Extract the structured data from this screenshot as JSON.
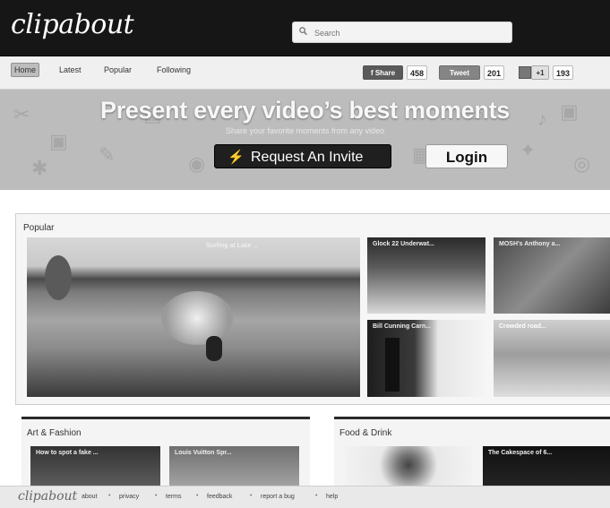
{
  "header": {
    "logo": "clipabout",
    "search_placeholder": "Search"
  },
  "nav": {
    "items": [
      "Home",
      "Latest",
      "Popular",
      "Following"
    ],
    "social": {
      "facebook": "f Share",
      "facebook_count": "458",
      "twitter": "Tweet",
      "twitter_count": "201",
      "plusone": "+1",
      "plusone_count": "193"
    }
  },
  "hero": {
    "title": "Present every video’s best moments",
    "subtitle": "Share your favorite moments from any video",
    "invite_button": "Request An Invite",
    "login_button": "Login"
  },
  "popular": {
    "title": "Popular",
    "featured_title": "Surfing at Lake ...",
    "videos": [
      {
        "title": "Glock 22 Underwat..."
      },
      {
        "title": "MOSH's Anthony a..."
      },
      {
        "title": "Bill Cunning Carn..."
      },
      {
        "title": "Crowded road..."
      }
    ]
  },
  "categories": [
    {
      "title": "Art & Fashion",
      "videos": [
        "How to spot a fake ...",
        "Louis Vuitton Spr..."
      ]
    },
    {
      "title": "Food & Drink",
      "videos": [
        "",
        "The Cakespace of 6..."
      ]
    }
  ],
  "footer": {
    "logo": "clipabout",
    "links": [
      "about",
      "privacy",
      "terms",
      "feedback",
      "report a bug",
      "help"
    ]
  },
  "colors": {
    "topbar": "#161616",
    "hero": "#bcbcbc",
    "invite_button": "#1f1f1f"
  }
}
